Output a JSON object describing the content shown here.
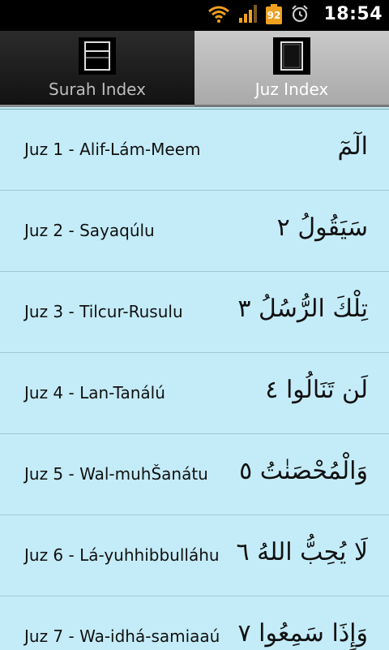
{
  "status_bar": {
    "time": "18:54",
    "battery_level": "92",
    "icons": [
      "wifi-icon",
      "signal-icon",
      "battery-icon",
      "alarm-icon"
    ]
  },
  "tabs": [
    {
      "label": "Surah Index",
      "selected": false
    },
    {
      "label": "Juz Index",
      "selected": true
    }
  ],
  "juz_list": [
    {
      "label": "Juz 1 - Alif-Lám-Meem",
      "arabic": "الٓمٓ"
    },
    {
      "label": "Juz 2 - Sayaqúlu",
      "arabic": "سَيَقُولُ ٢"
    },
    {
      "label": "Juz 3 - Tilcur-Rusulu",
      "arabic": "تِلْكَ الرُّسُلُ ٣"
    },
    {
      "label": "Juz 4 - Lan-Tanálú",
      "arabic": "لَن تَنَالُوا ٤"
    },
    {
      "label": "Juz 5 - Wal-muhŠanátu",
      "arabic": "وَالْمُحْصَنٰتُ ٥"
    },
    {
      "label": "Juz 6 - Lá-yuhhibbulláhu",
      "arabic": "لَا يُحِبُّ اللهُ ٦"
    },
    {
      "label": "Juz 7 - Wa-idhá-samiaaú",
      "arabic": "وَإِذَا سَمِعُوا ٧"
    }
  ],
  "colors": {
    "list_background": "#c4ecf8",
    "status_bar": "#000000",
    "battery": "#f0a020"
  }
}
